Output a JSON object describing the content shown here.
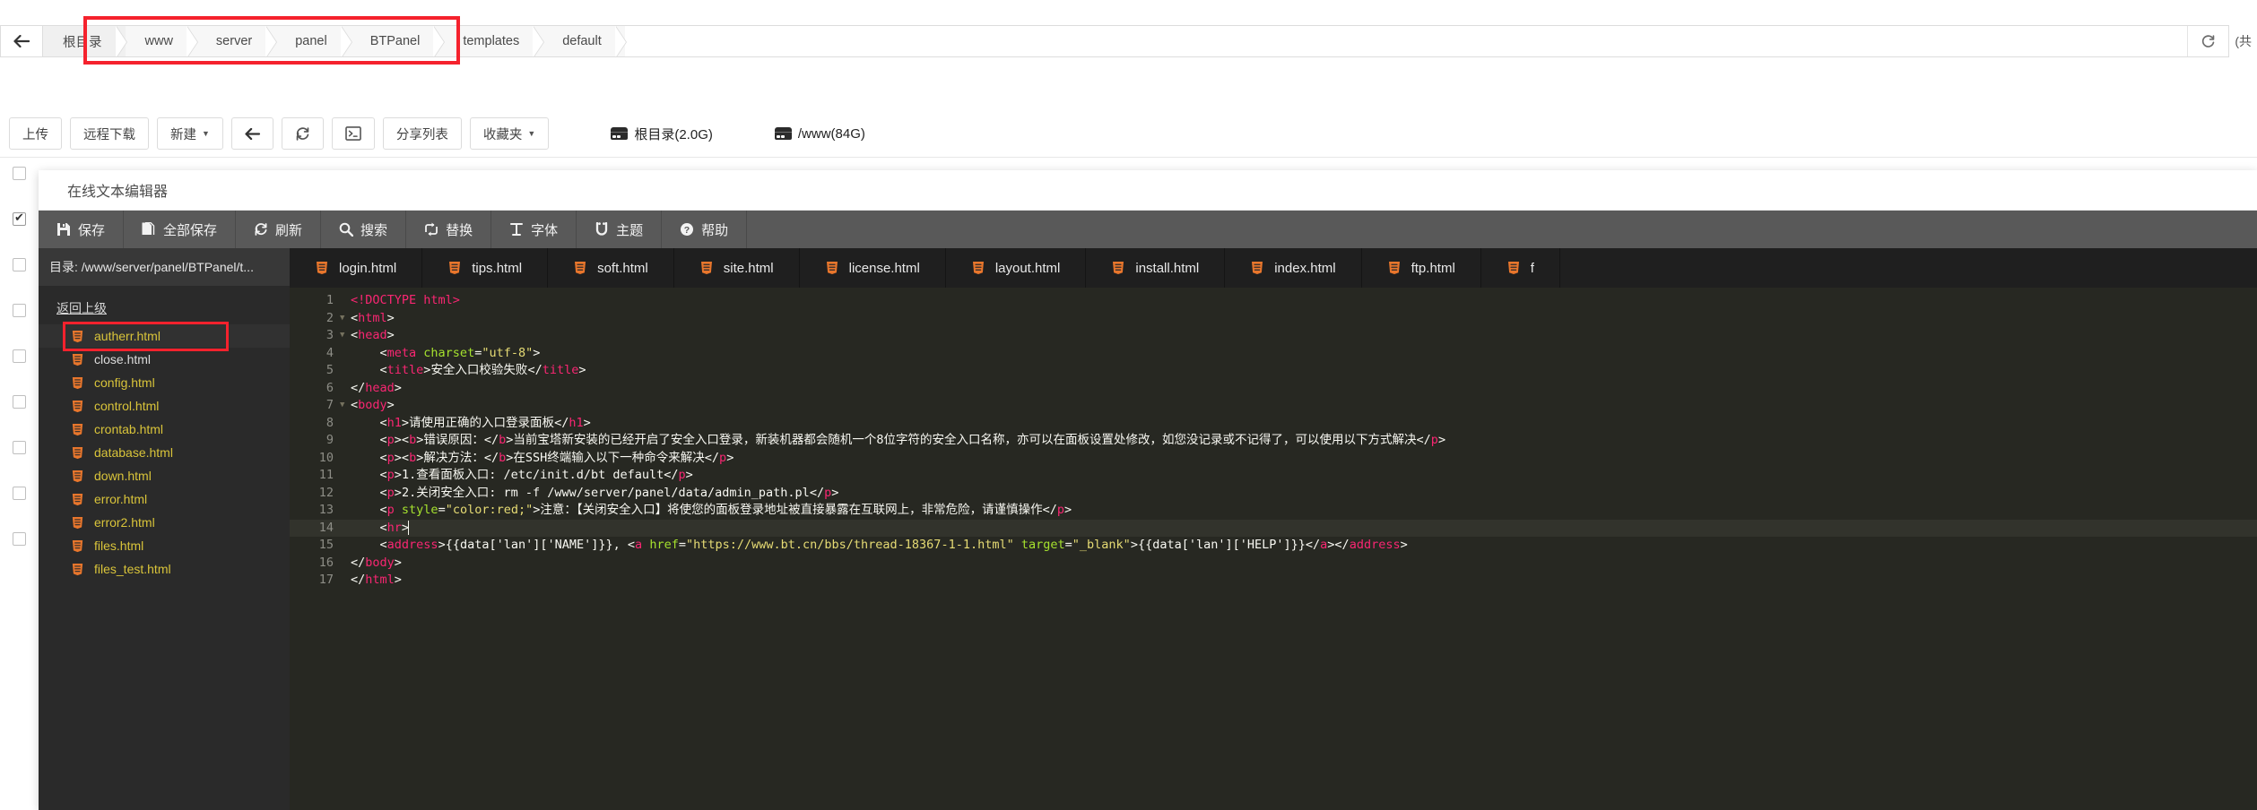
{
  "topbar": {
    "back_icon": "arrow-left-icon",
    "root_label": "根目录",
    "crumbs": [
      "www",
      "server",
      "panel",
      "BTPanel",
      "templates",
      "default"
    ],
    "refresh_icon": "refresh-icon",
    "right_text": "(共"
  },
  "toolbar": {
    "upload": "上传",
    "remote_download": "远程下载",
    "new": "新建",
    "back_icon": "arrow-left-icon",
    "refresh_icon": "refresh-icon",
    "terminal_icon": "terminal-icon",
    "share_list": "分享列表",
    "favorites": "收藏夹",
    "disk_root": "根目录(2.0G)",
    "disk_www": "/www(84G)"
  },
  "editor": {
    "title": "在线文本编辑器",
    "tools": [
      {
        "label": "保存",
        "icon": "save-icon"
      },
      {
        "label": "全部保存",
        "icon": "save-all-icon"
      },
      {
        "label": "刷新",
        "icon": "refresh-icon"
      },
      {
        "label": "搜索",
        "icon": "search-icon"
      },
      {
        "label": "替换",
        "icon": "replace-icon"
      },
      {
        "label": "字体",
        "icon": "font-icon"
      },
      {
        "label": "主题",
        "icon": "theme-icon"
      },
      {
        "label": "帮助",
        "icon": "help-icon"
      }
    ],
    "directory_label": "目录: /www/server/panel/BTPanel/t...",
    "go_up": "返回上级",
    "files": [
      {
        "name": "autherr.html",
        "selected": true,
        "plain": false
      },
      {
        "name": "close.html",
        "selected": false,
        "plain": true
      },
      {
        "name": "config.html",
        "selected": false,
        "plain": false
      },
      {
        "name": "control.html",
        "selected": false,
        "plain": false
      },
      {
        "name": "crontab.html",
        "selected": false,
        "plain": false
      },
      {
        "name": "database.html",
        "selected": false,
        "plain": false
      },
      {
        "name": "down.html",
        "selected": false,
        "plain": false
      },
      {
        "name": "error.html",
        "selected": false,
        "plain": false
      },
      {
        "name": "error2.html",
        "selected": false,
        "plain": false
      },
      {
        "name": "files.html",
        "selected": false,
        "plain": false
      },
      {
        "name": "files_test.html",
        "selected": false,
        "plain": false
      }
    ],
    "tabs": [
      "login.html",
      "tips.html",
      "soft.html",
      "site.html",
      "license.html",
      "layout.html",
      "install.html",
      "index.html",
      "ftp.html",
      "f"
    ],
    "line_count": 17,
    "current_line": 14,
    "lines": [
      {
        "n": 1,
        "fold": false,
        "indent": 0,
        "parts": [
          {
            "c": "t-tag",
            "t": "<!DOCTYPE html>"
          }
        ]
      },
      {
        "n": 2,
        "fold": true,
        "indent": 0,
        "parts": [
          {
            "c": "t-punc",
            "t": "<"
          },
          {
            "c": "t-tag",
            "t": "html"
          },
          {
            "c": "t-punc",
            "t": ">"
          }
        ]
      },
      {
        "n": 3,
        "fold": true,
        "indent": 0,
        "parts": [
          {
            "c": "t-punc",
            "t": "<"
          },
          {
            "c": "t-tag",
            "t": "head"
          },
          {
            "c": "t-punc",
            "t": ">"
          }
        ]
      },
      {
        "n": 4,
        "fold": false,
        "indent": 4,
        "parts": [
          {
            "c": "t-punc",
            "t": "<"
          },
          {
            "c": "t-tag",
            "t": "meta "
          },
          {
            "c": "t-attr",
            "t": "charset"
          },
          {
            "c": "t-punc",
            "t": "="
          },
          {
            "c": "t-str",
            "t": "\"utf-8\""
          },
          {
            "c": "t-punc",
            "t": ">"
          }
        ]
      },
      {
        "n": 5,
        "fold": false,
        "indent": 4,
        "parts": [
          {
            "c": "t-punc",
            "t": "<"
          },
          {
            "c": "t-tag",
            "t": "title"
          },
          {
            "c": "t-punc",
            "t": ">"
          },
          {
            "c": "t-txt",
            "t": "安全入口校验失败"
          },
          {
            "c": "t-punc",
            "t": "</"
          },
          {
            "c": "t-tag",
            "t": "title"
          },
          {
            "c": "t-punc",
            "t": ">"
          }
        ]
      },
      {
        "n": 6,
        "fold": false,
        "indent": 0,
        "parts": [
          {
            "c": "t-punc",
            "t": "</"
          },
          {
            "c": "t-tag",
            "t": "head"
          },
          {
            "c": "t-punc",
            "t": ">"
          }
        ]
      },
      {
        "n": 7,
        "fold": true,
        "indent": 0,
        "parts": [
          {
            "c": "t-punc",
            "t": "<"
          },
          {
            "c": "t-tag",
            "t": "body"
          },
          {
            "c": "t-punc",
            "t": ">"
          }
        ]
      },
      {
        "n": 8,
        "fold": false,
        "indent": 4,
        "parts": [
          {
            "c": "t-punc",
            "t": "<"
          },
          {
            "c": "t-tag",
            "t": "h1"
          },
          {
            "c": "t-punc",
            "t": ">"
          },
          {
            "c": "t-txt",
            "t": "请使用正确的入口登录面板"
          },
          {
            "c": "t-punc",
            "t": "</"
          },
          {
            "c": "t-tag",
            "t": "h1"
          },
          {
            "c": "t-punc",
            "t": ">"
          }
        ]
      },
      {
        "n": 9,
        "fold": false,
        "indent": 4,
        "parts": [
          {
            "c": "t-punc",
            "t": "<"
          },
          {
            "c": "t-tag",
            "t": "p"
          },
          {
            "c": "t-punc",
            "t": "><"
          },
          {
            "c": "t-tag",
            "t": "b"
          },
          {
            "c": "t-punc",
            "t": ">"
          },
          {
            "c": "t-txt",
            "t": "错误原因："
          },
          {
            "c": "t-punc",
            "t": "</"
          },
          {
            "c": "t-tag",
            "t": "b"
          },
          {
            "c": "t-punc",
            "t": ">"
          },
          {
            "c": "t-txt",
            "t": "当前宝塔新安装的已经开启了安全入口登录，新装机器都会随机一个8位字符的安全入口名称，亦可以在面板设置处修改，如您没记录或不记得了，可以使用以下方式解决"
          },
          {
            "c": "t-punc",
            "t": "</"
          },
          {
            "c": "t-tag",
            "t": "p"
          },
          {
            "c": "t-punc",
            "t": ">"
          }
        ]
      },
      {
        "n": 10,
        "fold": false,
        "indent": 4,
        "parts": [
          {
            "c": "t-punc",
            "t": "<"
          },
          {
            "c": "t-tag",
            "t": "p"
          },
          {
            "c": "t-punc",
            "t": "><"
          },
          {
            "c": "t-tag",
            "t": "b"
          },
          {
            "c": "t-punc",
            "t": ">"
          },
          {
            "c": "t-txt",
            "t": "解决方法："
          },
          {
            "c": "t-punc",
            "t": "</"
          },
          {
            "c": "t-tag",
            "t": "b"
          },
          {
            "c": "t-punc",
            "t": ">"
          },
          {
            "c": "t-txt",
            "t": "在SSH终端输入以下一种命令来解决"
          },
          {
            "c": "t-punc",
            "t": "</"
          },
          {
            "c": "t-tag",
            "t": "p"
          },
          {
            "c": "t-punc",
            "t": ">"
          }
        ]
      },
      {
        "n": 11,
        "fold": false,
        "indent": 4,
        "parts": [
          {
            "c": "t-punc",
            "t": "<"
          },
          {
            "c": "t-tag",
            "t": "p"
          },
          {
            "c": "t-punc",
            "t": ">"
          },
          {
            "c": "t-txt",
            "t": "1.查看面板入口: /etc/init.d/bt default"
          },
          {
            "c": "t-punc",
            "t": "</"
          },
          {
            "c": "t-tag",
            "t": "p"
          },
          {
            "c": "t-punc",
            "t": ">"
          }
        ]
      },
      {
        "n": 12,
        "fold": false,
        "indent": 4,
        "parts": [
          {
            "c": "t-punc",
            "t": "<"
          },
          {
            "c": "t-tag",
            "t": "p"
          },
          {
            "c": "t-punc",
            "t": ">"
          },
          {
            "c": "t-txt",
            "t": "2.关闭安全入口: rm -f /www/server/panel/data/admin_path.pl"
          },
          {
            "c": "t-punc",
            "t": "</"
          },
          {
            "c": "t-tag",
            "t": "p"
          },
          {
            "c": "t-punc",
            "t": ">"
          }
        ]
      },
      {
        "n": 13,
        "fold": false,
        "indent": 4,
        "parts": [
          {
            "c": "t-punc",
            "t": "<"
          },
          {
            "c": "t-tag",
            "t": "p "
          },
          {
            "c": "t-attr",
            "t": "style"
          },
          {
            "c": "t-punc",
            "t": "="
          },
          {
            "c": "t-str",
            "t": "\"color:red;\""
          },
          {
            "c": "t-punc",
            "t": ">"
          },
          {
            "c": "t-txt",
            "t": "注意：【关闭安全入口】将使您的面板登录地址被直接暴露在互联网上，非常危险，请谨慎操作"
          },
          {
            "c": "t-punc",
            "t": "</"
          },
          {
            "c": "t-tag",
            "t": "p"
          },
          {
            "c": "t-punc",
            "t": ">"
          }
        ]
      },
      {
        "n": 14,
        "fold": false,
        "indent": 4,
        "parts": [
          {
            "c": "t-punc",
            "t": "<"
          },
          {
            "c": "t-tag",
            "t": "hr"
          },
          {
            "c": "t-punc",
            "t": ">"
          }
        ]
      },
      {
        "n": 15,
        "fold": false,
        "indent": 4,
        "parts": [
          {
            "c": "t-punc",
            "t": "<"
          },
          {
            "c": "t-tag",
            "t": "address"
          },
          {
            "c": "t-punc",
            "t": ">"
          },
          {
            "c": "t-txt",
            "t": "{{data['lan']['NAME']}}, "
          },
          {
            "c": "t-punc",
            "t": "<"
          },
          {
            "c": "t-tag",
            "t": "a "
          },
          {
            "c": "t-attr",
            "t": "href"
          },
          {
            "c": "t-punc",
            "t": "="
          },
          {
            "c": "t-str",
            "t": "\"https://www.bt.cn/bbs/thread-18367-1-1.html\""
          },
          {
            "c": "t-punc",
            "t": " "
          },
          {
            "c": "t-attr",
            "t": "target"
          },
          {
            "c": "t-punc",
            "t": "="
          },
          {
            "c": "t-str",
            "t": "\"_blank\""
          },
          {
            "c": "t-punc",
            "t": ">"
          },
          {
            "c": "t-txt",
            "t": "{{data['lan']['HELP']}}"
          },
          {
            "c": "t-punc",
            "t": "</"
          },
          {
            "c": "t-tag",
            "t": "a"
          },
          {
            "c": "t-punc",
            "t": "></"
          },
          {
            "c": "t-tag",
            "t": "address"
          },
          {
            "c": "t-punc",
            "t": ">"
          }
        ]
      },
      {
        "n": 16,
        "fold": false,
        "indent": 0,
        "parts": [
          {
            "c": "t-punc",
            "t": "</"
          },
          {
            "c": "t-tag",
            "t": "body"
          },
          {
            "c": "t-punc",
            "t": ">"
          }
        ]
      },
      {
        "n": 17,
        "fold": false,
        "indent": 0,
        "parts": [
          {
            "c": "t-punc",
            "t": "</"
          },
          {
            "c": "t-tag",
            "t": "html"
          },
          {
            "c": "t-punc",
            "t": ">"
          }
        ]
      }
    ]
  },
  "colors": {
    "annotation_red": "#f5222d",
    "toolbar_dark": "#595959",
    "editor_bg": "#272822",
    "sidebar_bg": "#2a2a2a",
    "file_yellow": "#d9c43a",
    "html5_orange": "#e8762c"
  }
}
